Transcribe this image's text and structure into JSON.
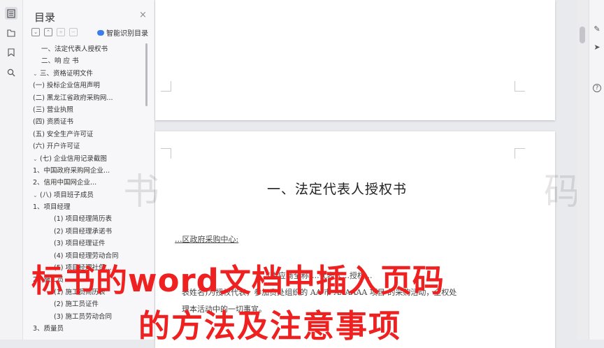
{
  "rail": {
    "icons": [
      "outline-icon",
      "bookmark-list-icon",
      "bookmark-icon",
      "search-icon"
    ]
  },
  "toc": {
    "title": "目录",
    "close": "×",
    "smart_label": "智能识别目录",
    "items": [
      {
        "label": "一、法定代表人授权书",
        "indent": 1,
        "caret": ""
      },
      {
        "label": "二、响 应 书",
        "indent": 1,
        "caret": ""
      },
      {
        "label": "三、资格证明文件",
        "indent": 0,
        "caret": "v"
      },
      {
        "label": "(一) 投标企业信用声明",
        "indent": 2,
        "caret": ""
      },
      {
        "label": "(二) 黑龙江省政府采购网...",
        "indent": 2,
        "caret": ""
      },
      {
        "label": "(三) 营业执照",
        "indent": 2,
        "caret": ""
      },
      {
        "label": "(四) 资质证书",
        "indent": 2,
        "caret": ""
      },
      {
        "label": "(五) 安全生产许可证",
        "indent": 2,
        "caret": ""
      },
      {
        "label": "(六) 开户许可证",
        "indent": 2,
        "caret": ""
      },
      {
        "label": "(七) 企业信用记录截图",
        "indent": 1,
        "caret": "v"
      },
      {
        "label": "1、中国政府采购网企业...",
        "indent": 2,
        "caret": ""
      },
      {
        "label": "2、信用中国网企业...",
        "indent": 2,
        "caret": ""
      },
      {
        "label": "(八) 项目班子成员",
        "indent": 1,
        "caret": "v"
      },
      {
        "label": "1、项目经理",
        "indent": 2,
        "caret": ""
      },
      {
        "label": "(1) 项目经理简历表",
        "indent": 3,
        "caret": ""
      },
      {
        "label": "(2) 项目经理承诺书",
        "indent": 3,
        "caret": ""
      },
      {
        "label": "(3) 项目经理证件",
        "indent": 3,
        "caret": ""
      },
      {
        "label": "(4) 项目经理劳动合同",
        "indent": 3,
        "caret": ""
      },
      {
        "label": "(5) 项目经理社保...",
        "indent": 3,
        "caret": ""
      },
      {
        "label": "2、施工员",
        "indent": 2,
        "caret": ""
      },
      {
        "label": "(1) 施工员简历表",
        "indent": 3,
        "caret": ""
      },
      {
        "label": "(2) 施工员证件",
        "indent": 3,
        "caret": ""
      },
      {
        "label": "(3) 施工员劳动合同",
        "indent": 3,
        "caret": ""
      },
      {
        "label": "3、质量员",
        "indent": 2,
        "caret": ""
      }
    ]
  },
  "document": {
    "heading": "一、法定代表人授权书",
    "line1": "...区政府采购中心:",
    "line2": "...(供应商全称)...代表人...授权...",
    "line3": "表姓名)为授权代表，参加贵处组织的 AA 市 AAAAAA 项目 的采购活动，全权处",
    "line4": "理本活动中的一切事宜。"
  },
  "right_tools": [
    "edit-icon",
    "select-cursor-icon",
    "help-icon"
  ],
  "watermark": {
    "left": "书",
    "right": "码"
  },
  "caption": {
    "line1": "标书的word文档中插入页码",
    "line2": "的方法及注意事项"
  },
  "colors": {
    "caption": "#ee2020",
    "accent": "#3b7df0"
  }
}
